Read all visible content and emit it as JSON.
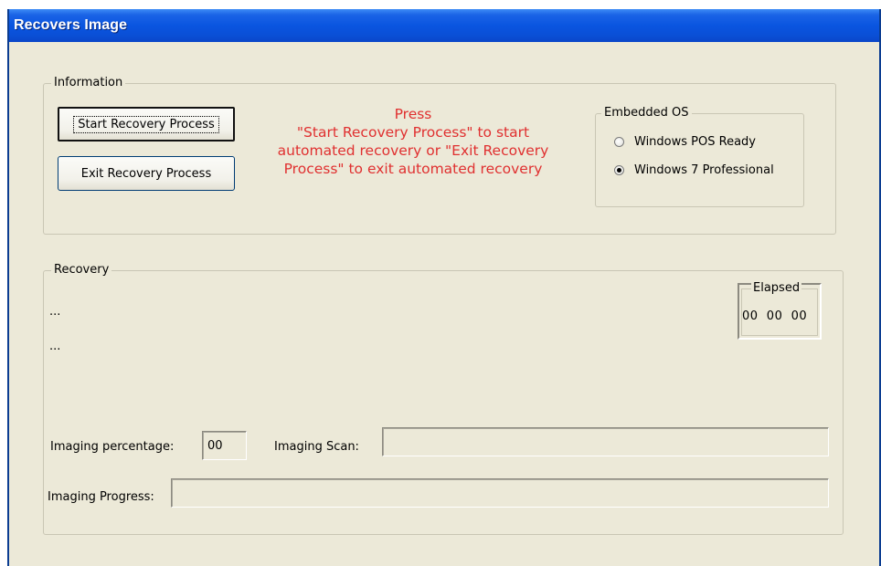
{
  "window": {
    "title": "Recovers Image"
  },
  "information": {
    "legend": "Information",
    "start_button": "Start Recovery Process",
    "exit_button": "Exit Recovery Process",
    "instructions": {
      "line1": "Press",
      "line2": "\"Start Recovery Process\" to start",
      "line3": "automated recovery or \"Exit Recovery",
      "line4": "Process\" to exit automated recovery"
    },
    "instructions_color": "#e03030",
    "embedded_os": {
      "legend": "Embedded OS",
      "options": [
        {
          "label": "Windows POS Ready",
          "selected": false
        },
        {
          "label": "Windows 7 Professional",
          "selected": true
        }
      ]
    }
  },
  "recovery": {
    "legend": "Recovery",
    "status_line1": "...",
    "status_line2": "...",
    "elapsed": {
      "label": "Elapsed",
      "value": "00  00  00"
    },
    "imaging_percentage_label": "Imaging percentage:",
    "imaging_percentage_value": "00",
    "imaging_scan_label": "Imaging Scan:",
    "imaging_scan_value": "",
    "imaging_progress_label": "Imaging Progress:",
    "imaging_progress_fraction": 0
  },
  "colors": {
    "titlebar": "#0a55e0",
    "window_background": "#ece9d8",
    "button_border": "#003c74"
  }
}
